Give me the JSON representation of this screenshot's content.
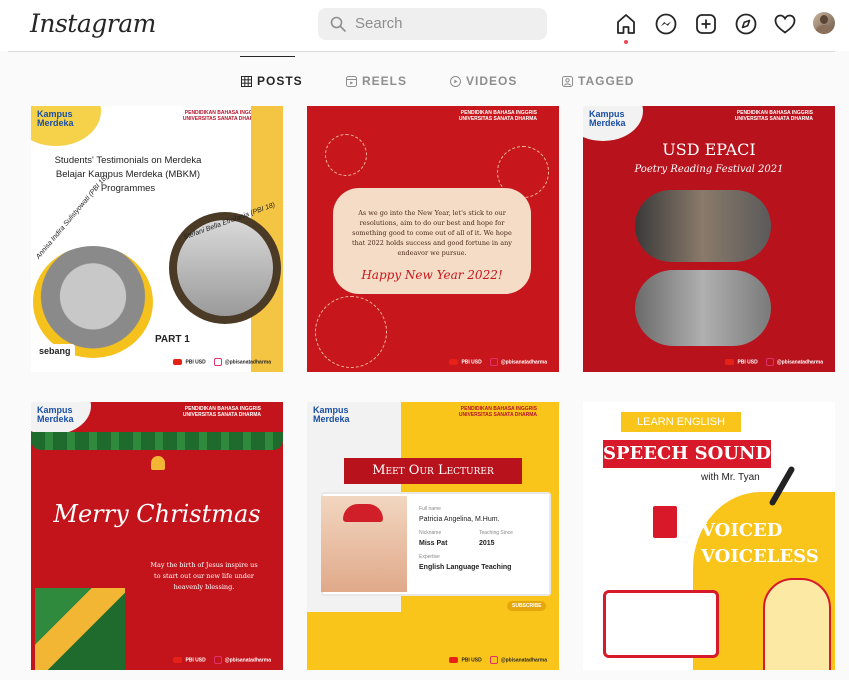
{
  "topbar": {
    "logo": "Instagram",
    "search_placeholder": "Search",
    "icons": [
      "home-icon",
      "messenger-icon",
      "new-post-icon",
      "explore-icon",
      "activity-heart-icon",
      "profile-avatar"
    ]
  },
  "tabs": [
    {
      "label": "POSTS",
      "icon": "grid-icon",
      "active": true
    },
    {
      "label": "REELS",
      "icon": "reels-icon",
      "active": false
    },
    {
      "label": "VIDEOS",
      "icon": "video-icon",
      "active": false
    },
    {
      "label": "TAGGED",
      "icon": "tagged-icon",
      "active": false
    }
  ],
  "posts": [
    {
      "brand": "Kampus\nMerdeka",
      "dept": "PENDIDIKAN BAHASA INGGRIS\nUNIVERSITAS SANATA DHARMA",
      "title": "Students' Testimonials on Merdeka Belajar Kampus Merdeka (MBKM) Programmes",
      "name_left": "Annisa Indira Sulistyowati (PBI 18)",
      "name_right": "Stefani Bella Efrafania (PBI 18)",
      "part": "PART 1",
      "partner": "sebang",
      "footer_yt": "PBI USD",
      "footer_ig": "@pbisanatadharma"
    },
    {
      "dept": "PENDIDIKAN BAHASA INGGRIS\nUNIVERSITAS SANATA DHARMA",
      "message": "As we go into the New Year, let's stick to our resolutions, aim to do our best and hope for something good to come out of all of it. We hope that 2022 holds success and good fortune in any endeavor we pursue.",
      "greeting": "Happy New Year 2022!",
      "footer_yt": "PBI USD",
      "footer_ig": "@pbisanatadharma"
    },
    {
      "brand": "Kampus\nMerdeka",
      "dept": "PENDIDIKAN BAHASA INGGRIS\nUNIVERSITAS SANATA DHARMA",
      "title": "USD EPACI",
      "subtitle": "Poetry Reading Festival 2021",
      "footer_yt": "PBI USD",
      "footer_ig": "@pbisanatadharma"
    },
    {
      "brand": "Kampus\nMerdeka",
      "dept": "PENDIDIKAN BAHASA INGGRIS\nUNIVERSITAS SANATA DHARMA",
      "greeting": "Merry Christmas",
      "message": "May the birth of Jesus inspire us to start out our new life under heavenly blessing.",
      "footer_yt": "PBI USD",
      "footer_ig": "@pbisanatadharma"
    },
    {
      "brand": "Kampus\nMerdeka",
      "dept": "PENDIDIKAN BAHASA INGGRIS\nUNIVERSITAS SANATA DHARMA",
      "title": "Meet Our Lecturer",
      "fullname_label": "Full name",
      "fullname": "Patricia Angelina, M.Hum.",
      "nickname_label": "Nickname",
      "nickname": "Miss Pat",
      "since_label": "Teaching Since",
      "since": "2015",
      "expertise_label": "Expertise",
      "expertise": "English Language Teaching",
      "subscribe": "SUBSCRIBE",
      "footer_yt": "PBI USD",
      "footer_ig": "@pbisanatadharma"
    },
    {
      "kicker": "LEARN ENGLISH",
      "title": "SPEECH SOUND",
      "subtitle": "with Mr. Tyan",
      "topic1": "VOICED",
      "topic2": "VOICELESS"
    }
  ]
}
